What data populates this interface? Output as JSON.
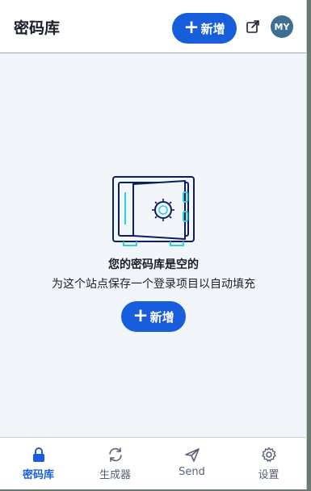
{
  "header": {
    "title": "密码库",
    "new_button_label": "新增",
    "avatar_initials": "MY"
  },
  "empty_state": {
    "title": "您的密码库是空的",
    "description": "为这个站点保存一个登录项目以自动填充",
    "new_button_label": "新增"
  },
  "nav": {
    "items": [
      {
        "label": "密码库",
        "icon": "lock-icon",
        "active": true
      },
      {
        "label": "生成器",
        "icon": "refresh-icon",
        "active": false
      },
      {
        "label": "Send",
        "icon": "send-icon",
        "active": false
      },
      {
        "label": "设置",
        "icon": "gear-icon",
        "active": false
      }
    ]
  },
  "colors": {
    "accent": "#175ddc",
    "avatar": "#3c6f92",
    "background": "#f2f5f9"
  }
}
